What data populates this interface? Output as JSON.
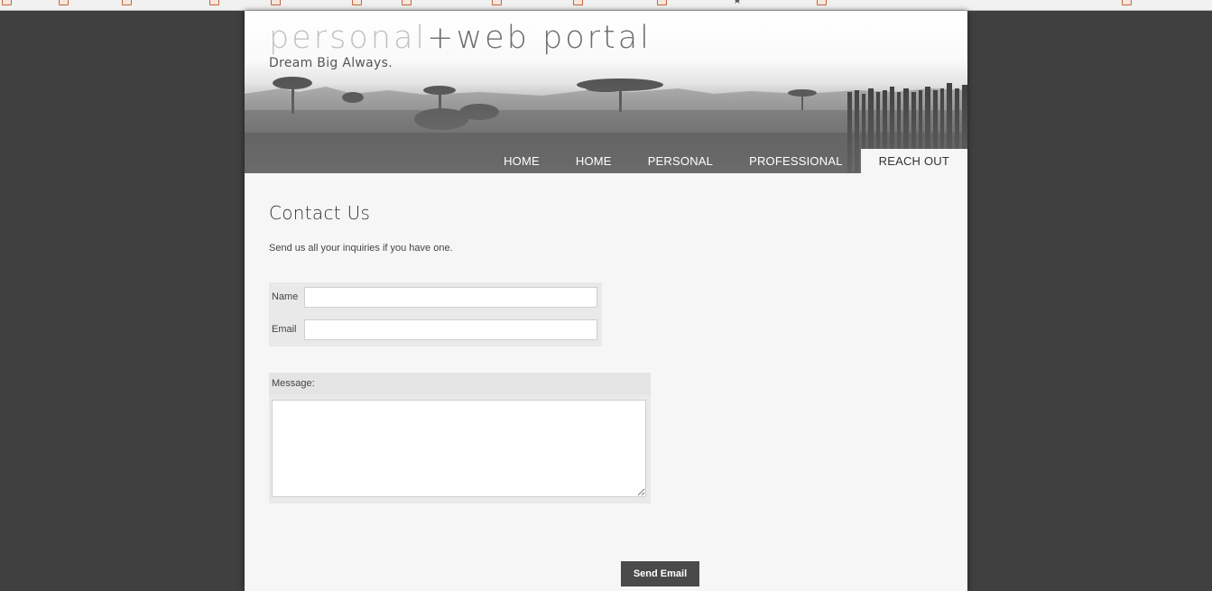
{
  "site": {
    "title_part1": "personal",
    "title_part2": "+web portal",
    "tagline": "Dream Big Always."
  },
  "nav": {
    "items": [
      {
        "label": "HOME",
        "active": false
      },
      {
        "label": "HOME",
        "active": false
      },
      {
        "label": "PERSONAL",
        "active": false
      },
      {
        "label": "PROFESSIONAL",
        "active": false
      },
      {
        "label": "REACH OUT",
        "active": true
      }
    ]
  },
  "main": {
    "title": "Contact Us",
    "intro": "Send us all your inquiries if you have one."
  },
  "form": {
    "name_label": "Name",
    "name_value": "",
    "email_label": "Email",
    "email_value": "",
    "message_label": "Message:",
    "message_value": "",
    "submit_label": "Send Email"
  },
  "colors": {
    "backdrop": "#404040",
    "page_bg": "#f6f6f6",
    "button_bg": "#4a4a4a",
    "nav_active_bg": "#f6f6f6"
  }
}
